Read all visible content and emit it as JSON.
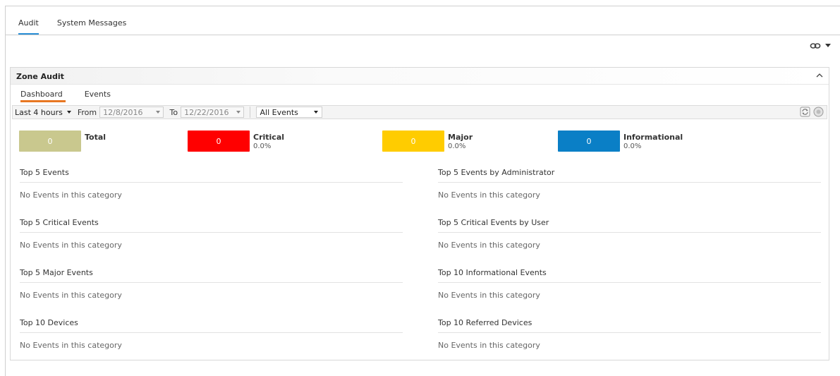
{
  "top_tabs": [
    {
      "label": "Audit",
      "active": true
    },
    {
      "label": "System Messages",
      "active": false
    }
  ],
  "panel": {
    "title": "Zone Audit",
    "sub_tabs": [
      {
        "label": "Dashboard",
        "active": true
      },
      {
        "label": "Events",
        "active": false
      }
    ],
    "filters": {
      "range": "Last 4 hours",
      "from_label": "From",
      "from_value": "12/8/2016",
      "to_label": "To",
      "to_value": "12/22/2016",
      "event_type": "All Events"
    },
    "counters": [
      {
        "name": "Total",
        "count": "0",
        "pct": "",
        "color": "#c9c88e"
      },
      {
        "name": "Critical",
        "count": "0",
        "pct": "0.0%",
        "color": "#ff0000"
      },
      {
        "name": "Major",
        "count": "0",
        "pct": "0.0%",
        "color": "#ffcc00"
      },
      {
        "name": "Informational",
        "count": "0",
        "pct": "0.0%",
        "color": "#0a7fc6"
      }
    ],
    "sections": [
      {
        "title": "Top 5 Events",
        "empty": "No Events in this category"
      },
      {
        "title": "Top 5 Events by Administrator",
        "empty": "No Events in this category"
      },
      {
        "title": "Top 5 Critical Events",
        "empty": "No Events in this category"
      },
      {
        "title": "Top 5 Critical Events by User",
        "empty": "No Events in this category"
      },
      {
        "title": "Top 5 Major Events",
        "empty": "No Events in this category"
      },
      {
        "title": "Top 10 Informational Events",
        "empty": "No Events in this category"
      },
      {
        "title": "Top 10 Devices",
        "empty": "No Events in this category"
      },
      {
        "title": "Top 10 Referred Devices",
        "empty": "No Events in this category"
      }
    ]
  },
  "icons": {
    "toolbar": [
      "link-icon",
      "dropdown-caret-icon"
    ],
    "panel": [
      "collapse-chevron-icon",
      "refresh-icon",
      "settings-icon"
    ]
  }
}
